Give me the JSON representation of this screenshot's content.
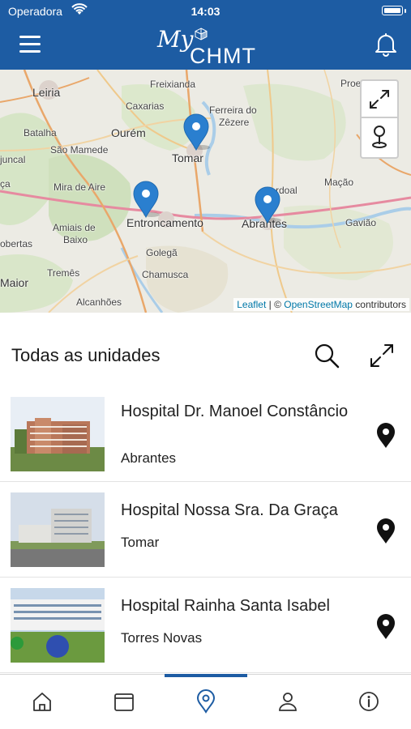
{
  "status_bar": {
    "carrier": "Operadora",
    "time": "14:03"
  },
  "header": {
    "logo_my": "My",
    "logo_brand": "CHMT"
  },
  "map": {
    "labels": {
      "leiria": "Leiria",
      "freixianda": "Freixianda",
      "caxarias": "Caxarias",
      "ferreira": "Ferreira do",
      "zezere": "Zêzere",
      "batalha": "Batalha",
      "ourem": "Ourém",
      "sao_mamede": "São Mamede",
      "tomar": "Tomar",
      "juncal": "juncal",
      "mira": "Mira de Aire",
      "ca": "ça",
      "amiais": "Amiais de",
      "baixo": "Baixo",
      "entroncamento": "Entroncamento",
      "abrantes": "Abrantes",
      "mouriscas": "rdoal",
      "macao": "Mação",
      "gaviao": "Gavião",
      "obertas": "obertas",
      "golega": "Golegã",
      "tremes": "Tremês",
      "chamusca": "Chamusca",
      "maior": "Maior",
      "alcanhoes": "Alcanhões",
      "proenca": "Proe"
    },
    "attribution": {
      "leaflet": "Leaflet",
      "sep": " | © ",
      "osm": "OpenStreetMap",
      "tail": " contributors"
    }
  },
  "section": {
    "title": "Todas as unidades"
  },
  "units": [
    {
      "name": "Hospital Dr. Manoel Constâncio",
      "city": "Abrantes"
    },
    {
      "name": "Hospital Nossa Sra. Da Graça",
      "city": "Tomar"
    },
    {
      "name": "Hospital Rainha Santa Isabel",
      "city": "Torres Novas"
    }
  ],
  "tabbar": {
    "tabs": [
      "home-icon",
      "calendar-icon",
      "map-pin-icon",
      "user-icon",
      "info-icon"
    ],
    "active_index": 2
  },
  "colors": {
    "brand": "#1d5ca3",
    "pin": "#2a7fcf"
  }
}
